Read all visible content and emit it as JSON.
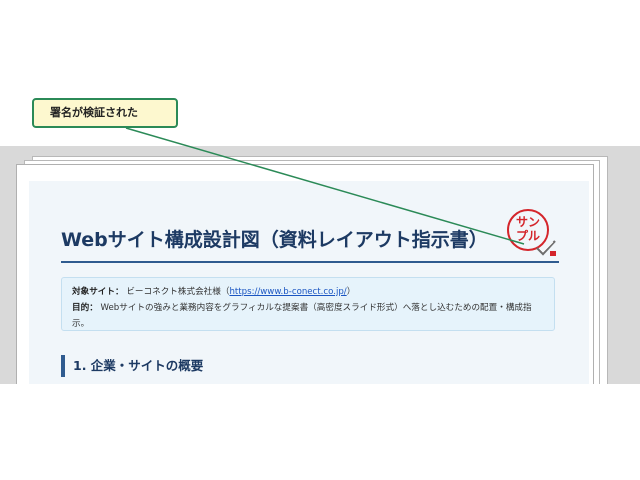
{
  "callout": {
    "text": "署名が検証された"
  },
  "document": {
    "title": "Webサイト構成設計図（資料レイアウト指示書）",
    "stamp": {
      "line1": "サン",
      "line2": "プル",
      "color": "#d4252b"
    },
    "info": {
      "target_label": "対象サイト：",
      "target_value": "ビーコネクト株式会社様（",
      "target_link": "https://www.b-conect.co.jp/",
      "target_close": "）",
      "purpose_label": "目的：",
      "purpose_value": "Webサイトの強みと業務内容をグラフィカルな提案書（高密度スライド形式）へ落とし込むための配置・構成指示。"
    },
    "section1": "1. 企業・サイトの概要"
  },
  "icons": {
    "signature": "signature-check-icon"
  },
  "colors": {
    "title": "#1d3a63",
    "accent": "#2f5b8f",
    "callout_border": "#2b8a57",
    "callout_bg": "#fdf8cf"
  }
}
